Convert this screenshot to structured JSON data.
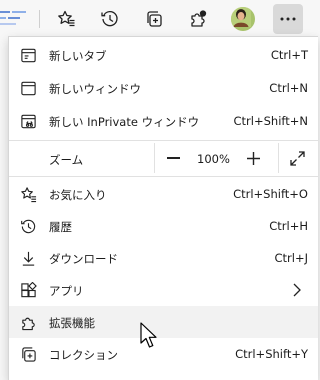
{
  "toolbar": {
    "icons": [
      "favorites-star-icon",
      "history-icon",
      "collections-icon",
      "extensions-icon",
      "profile-avatar",
      "more-menu-icon"
    ]
  },
  "menu": {
    "items": [
      {
        "label": "新しいタブ",
        "shortcut": "Ctrl+T",
        "icon": "new-tab-icon"
      },
      {
        "label": "新しいウィンドウ",
        "shortcut": "Ctrl+N",
        "icon": "new-window-icon"
      },
      {
        "label": "新しい InPrivate ウィンドウ",
        "shortcut": "Ctrl+Shift+N",
        "icon": "inprivate-window-icon"
      },
      {
        "label": "お気に入り",
        "shortcut": "Ctrl+Shift+O",
        "icon": "favorites-icon"
      },
      {
        "label": "履歴",
        "shortcut": "Ctrl+H",
        "icon": "history-icon"
      },
      {
        "label": "ダウンロード",
        "shortcut": "Ctrl+J",
        "icon": "download-icon"
      },
      {
        "label": "アプリ",
        "shortcut": "",
        "icon": "apps-icon"
      },
      {
        "label": "拡張機能",
        "shortcut": "",
        "icon": "extensions-icon"
      },
      {
        "label": "コレクション",
        "shortcut": "Ctrl+Shift+Y",
        "icon": "collections-icon"
      }
    ],
    "zoom": {
      "label": "ズーム",
      "value": "100%",
      "decrease": "—",
      "increase": "+"
    }
  },
  "colors": {
    "hover_bg": "#f2f2f2",
    "active_btn_bg": "#d9d9d9",
    "accent": "#1b1b1b"
  }
}
